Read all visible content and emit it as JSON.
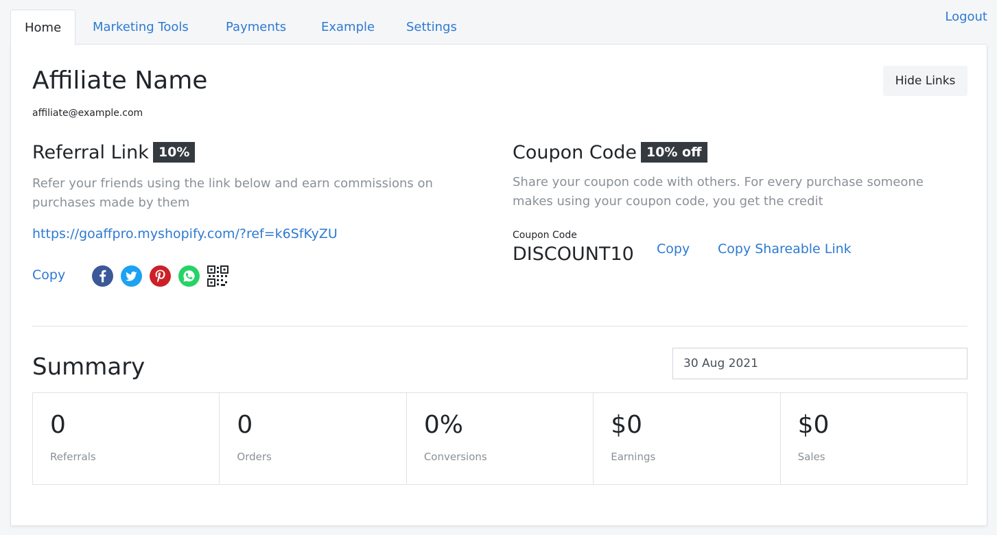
{
  "nav": {
    "tabs": [
      {
        "label": "Home"
      },
      {
        "label": "Marketing Tools"
      },
      {
        "label": "Payments"
      },
      {
        "label": "Example"
      },
      {
        "label": "Settings"
      }
    ],
    "logout_label": "Logout"
  },
  "profile": {
    "name": "Affiliate Name",
    "email": "affiliate@example.com",
    "hide_links_label": "Hide Links"
  },
  "referral": {
    "title": "Referral Link",
    "badge": "10%",
    "description": "Refer your friends using the link below and earn commissions on purchases made by them",
    "url": "https://goaffpro.myshopify.com/?ref=k6SfKyZU",
    "copy_label": "Copy",
    "share_icons": [
      "facebook-icon",
      "twitter-icon",
      "pinterest-icon",
      "whatsapp-icon",
      "qr-code-icon"
    ],
    "colors": {
      "facebook": "#3b5998",
      "twitter": "#1da1f2",
      "pinterest": "#cb2027",
      "whatsapp": "#25d366"
    }
  },
  "coupon": {
    "title": "Coupon Code",
    "badge": "10% off",
    "description": "Share your coupon code with others. For every purchase someone makes using your coupon code, you get the credit",
    "code_label": "Coupon Code",
    "code": "DISCOUNT10",
    "copy_label": "Copy",
    "share_link_label": "Copy Shareable Link"
  },
  "summary": {
    "title": "Summary",
    "date": "30 Aug 2021",
    "stats": [
      {
        "value": "0",
        "label": "Referrals"
      },
      {
        "value": "0",
        "label": "Orders"
      },
      {
        "value": "0%",
        "label": "Conversions"
      },
      {
        "value": "$0",
        "label": "Earnings"
      },
      {
        "value": "$0",
        "label": "Sales"
      }
    ]
  },
  "colors": {
    "accent": "#2c7ad2",
    "badge_bg": "#343a40",
    "muted": "#8a9097"
  }
}
